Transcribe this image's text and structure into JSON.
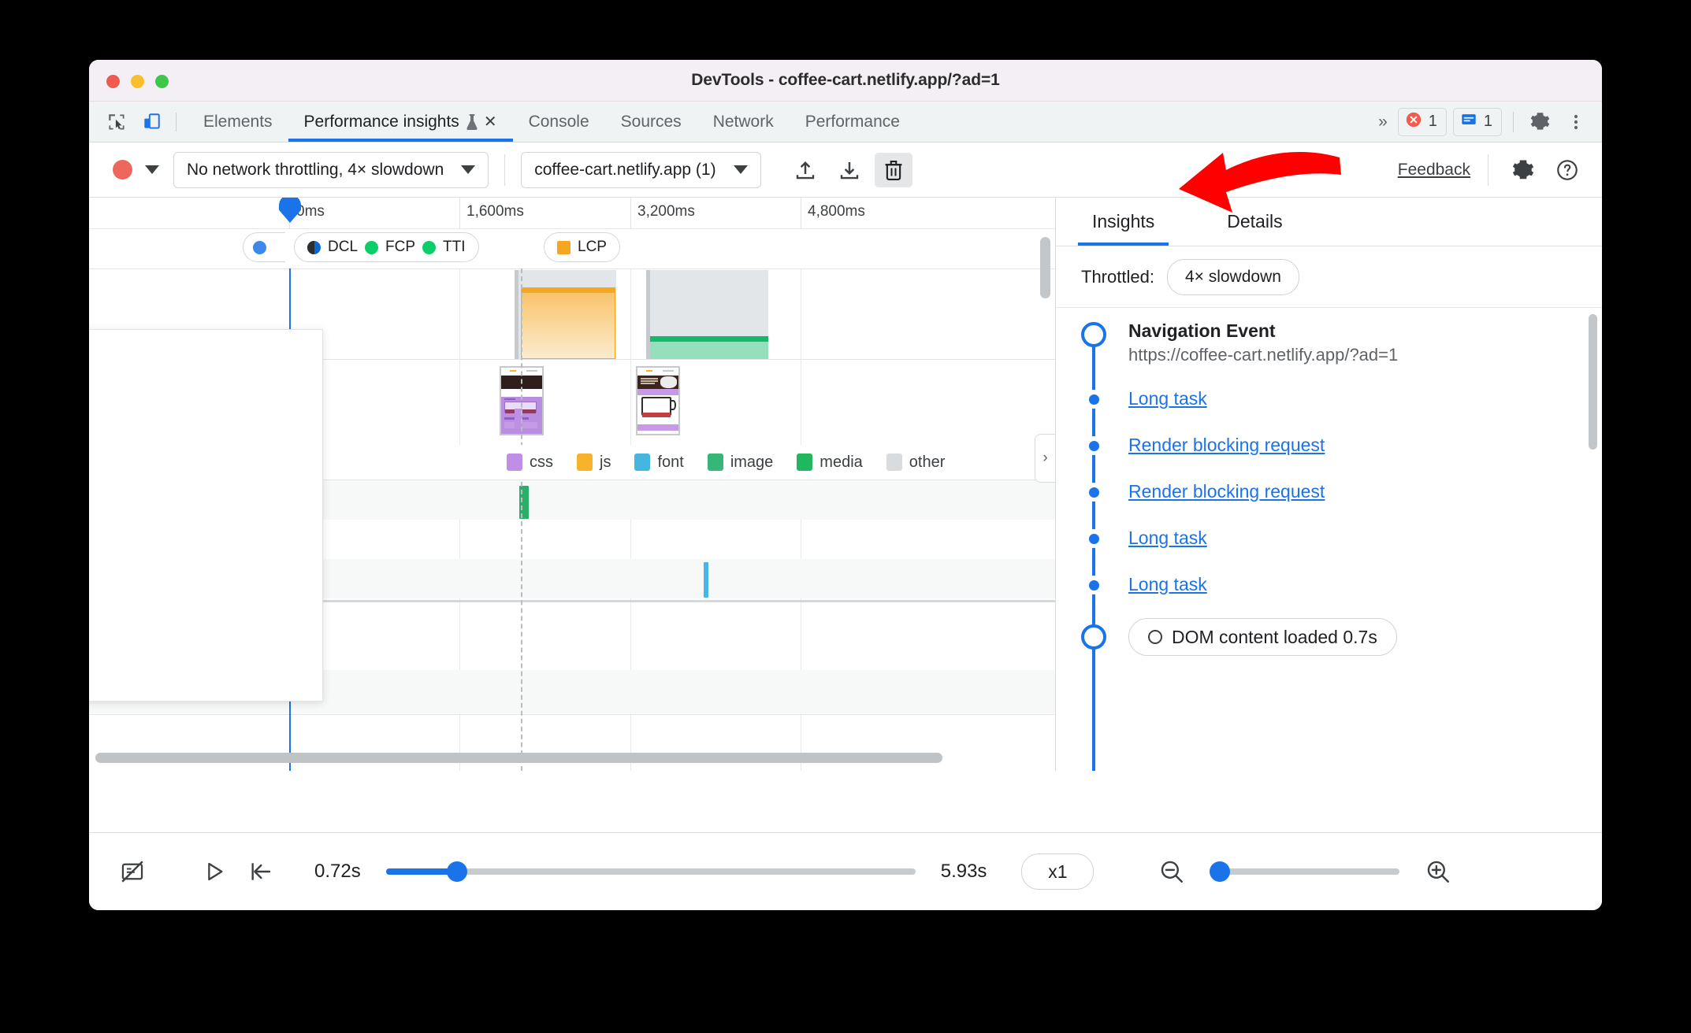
{
  "window": {
    "title": "DevTools - coffee-cart.netlify.app/?ad=1"
  },
  "tabbar": {
    "inspect_icon": "inspect-cursor-icon",
    "device_icon": "device-toolbar-icon",
    "tabs": [
      {
        "label": "Elements",
        "active": false
      },
      {
        "label": "Performance insights",
        "active": true,
        "experimental": true,
        "closable": true
      },
      {
        "label": "Console",
        "active": false
      },
      {
        "label": "Sources",
        "active": false
      },
      {
        "label": "Network",
        "active": false
      },
      {
        "label": "Performance",
        "active": false
      }
    ],
    "more_tabs": "»",
    "error_count": "1",
    "message_count": "1",
    "settings_icon": "gear-icon",
    "menu_icon": "three-dot-menu-icon"
  },
  "toolbar": {
    "record_button": "record-button",
    "record_dropdown": "record-options-caret",
    "throttling_value": "No network throttling, 4× slowdown",
    "recording_value": "coffee-cart.netlify.app (1)",
    "upload_icon": "upload-icon",
    "download_icon": "download-icon",
    "delete_icon": "trash-icon",
    "feedback_label": "Feedback",
    "settings_icon": "gear-icon",
    "help_icon": "help-icon"
  },
  "timeline": {
    "ticks": [
      "0ms",
      "1,600ms",
      "3,200ms",
      "4,800ms"
    ],
    "markers": [
      {
        "label": "DCL",
        "color": "#2e2e2e"
      },
      {
        "label": "FCP",
        "color": "#0bce6b"
      },
      {
        "label": "TTI",
        "color": "#0bce6b"
      },
      {
        "label": "LCP",
        "color": "#f5a623"
      }
    ],
    "legend": [
      {
        "label": "css",
        "color": "#bf8fe8"
      },
      {
        "label": "js",
        "color": "#f7b32b"
      },
      {
        "label": "font",
        "color": "#45b6e0"
      },
      {
        "label": "image",
        "color": "#35b877"
      },
      {
        "label": "media",
        "color": "#1fb85f"
      },
      {
        "label": "other",
        "color": "#d9dcde"
      }
    ],
    "collapse_handle": "›"
  },
  "insights": {
    "tabs": [
      {
        "label": "Insights",
        "active": true
      },
      {
        "label": "Details",
        "active": false
      }
    ],
    "throttled_label": "Throttled:",
    "throttled_value": "4× slowdown",
    "navigation_title": "Navigation Event",
    "navigation_url": "https://coffee-cart.netlify.app/?ad=1",
    "items": [
      {
        "label": "Long task"
      },
      {
        "label": "Render blocking request"
      },
      {
        "label": "Render blocking request"
      },
      {
        "label": "Long task"
      },
      {
        "label": "Long task"
      }
    ],
    "dcl_chip": "DOM content loaded 0.7s"
  },
  "bottombar": {
    "screenshot_toggle_icon": "screenshots-off-icon",
    "play_icon": "play-icon",
    "reset_icon": "jump-to-start-icon",
    "start_time": "0.72s",
    "end_time": "5.93s",
    "speed": "x1",
    "zoom_out_icon": "zoom-out-icon",
    "zoom_in_icon": "zoom-in-icon"
  },
  "annotation": {
    "arrow_color": "#ff0000",
    "points_to": "trash-icon"
  }
}
